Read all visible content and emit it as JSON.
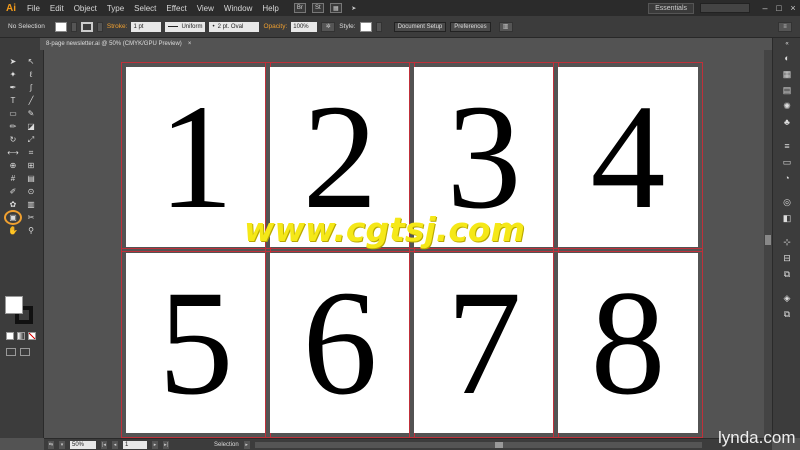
{
  "menubar": {
    "logo": "Ai",
    "items": [
      "File",
      "Edit",
      "Object",
      "Type",
      "Select",
      "Effect",
      "View",
      "Window",
      "Help"
    ],
    "btn1": "Br",
    "btn2": "St",
    "workspace": "Essentials"
  },
  "control": {
    "selection": "No Selection",
    "stroke_label": "Stroke:",
    "stroke_weight": "1 pt",
    "profile": "Uniform",
    "brush": "2 pt. Oval",
    "opacity_label": "Opacity:",
    "opacity": "100%",
    "style_label": "Style:",
    "document_setup": "Document Setup",
    "preferences": "Preferences"
  },
  "document": {
    "tab_title": "8-page newsletter.ai @ 50% (CMYK/GPU Preview)",
    "close": "×"
  },
  "artboards": [
    "1",
    "2",
    "3",
    "4",
    "5",
    "6",
    "7",
    "8"
  ],
  "watermark": "www.cgtsj.com",
  "status": {
    "zoom": "50%",
    "artboard": "1",
    "tool": "Selection"
  },
  "brand": "lynda.com",
  "colors": {
    "accent": "#f0a030",
    "artboard_border": "#c0303a",
    "watermark": "#f5e818"
  }
}
